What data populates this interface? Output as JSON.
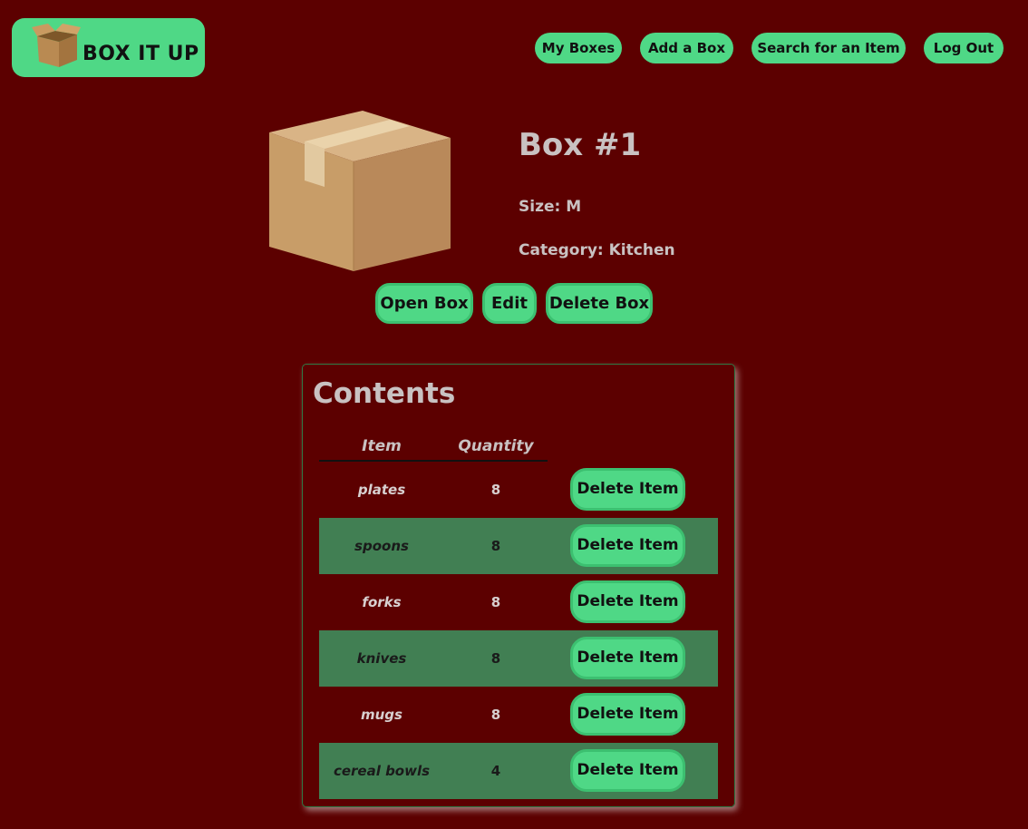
{
  "brand": {
    "name": "BOX IT UP",
    "icon": "cardboard-box-icon"
  },
  "nav": {
    "items": [
      {
        "label": "My Boxes"
      },
      {
        "label": "Add a Box"
      },
      {
        "label": "Search for an Item"
      },
      {
        "label": "Log Out"
      }
    ]
  },
  "box": {
    "title": "Box #1",
    "size": "Size: M",
    "category": "Category: Kitchen",
    "image": "cardboard-box-image",
    "actions": {
      "open": "Open Box",
      "edit": "Edit",
      "delete": "Delete Box"
    }
  },
  "contents": {
    "title": "Contents",
    "columns": {
      "item": "Item",
      "quantity": "Quantity"
    },
    "delete_label": "Delete Item",
    "rows": [
      {
        "item": "plates",
        "quantity": "8"
      },
      {
        "item": "spoons",
        "quantity": "8"
      },
      {
        "item": "forks",
        "quantity": "8"
      },
      {
        "item": "knives",
        "quantity": "8"
      },
      {
        "item": "mugs",
        "quantity": "8"
      },
      {
        "item": "cereal bowls",
        "quantity": "4"
      }
    ]
  },
  "colors": {
    "background": "#5c0000",
    "accent": "#4fd886",
    "row_alt": "#417f53",
    "text_light": "#c9c2c2"
  }
}
